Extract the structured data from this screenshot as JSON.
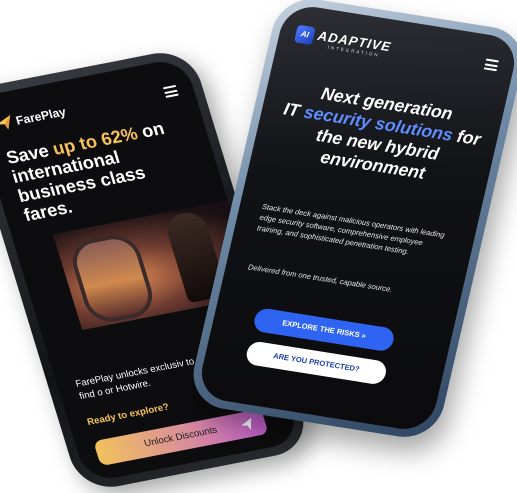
{
  "fareplay": {
    "brand": "FarePlay",
    "headline_prefix": "Save ",
    "headline_accent": "up to 62%",
    "headline_suffix": " on international business class fares.",
    "body": "FarePlay unlocks exclusiv to fares you won't find o or Hotwire.",
    "cta_text": "Ready to explore?",
    "button_label": "Unlock Discounts",
    "colors": {
      "accent": "#f7c35a",
      "button_start": "#f1c25d",
      "button_end": "#c45fd1"
    }
  },
  "adaptive": {
    "logo_mark": "AI",
    "brand": "ADAPTIVE",
    "brand_sub": "INTEGRATION",
    "headline_line1": "Next generation",
    "headline_prefix": "IT ",
    "headline_accent": "security solutions",
    "headline_suffix": " for the new hybrid environment",
    "body": "Stack the deck against malicious operators with leading edge security software, comprehensive employee training, and sophisticated penetration testing.",
    "body2": "Delivered from one trusted, capable source.",
    "button_primary": "EXPLORE THE RISKS »",
    "button_secondary": "ARE YOU PROTECTED?",
    "colors": {
      "accent": "#5f8cff",
      "primary_button": "#2f64f2"
    }
  }
}
